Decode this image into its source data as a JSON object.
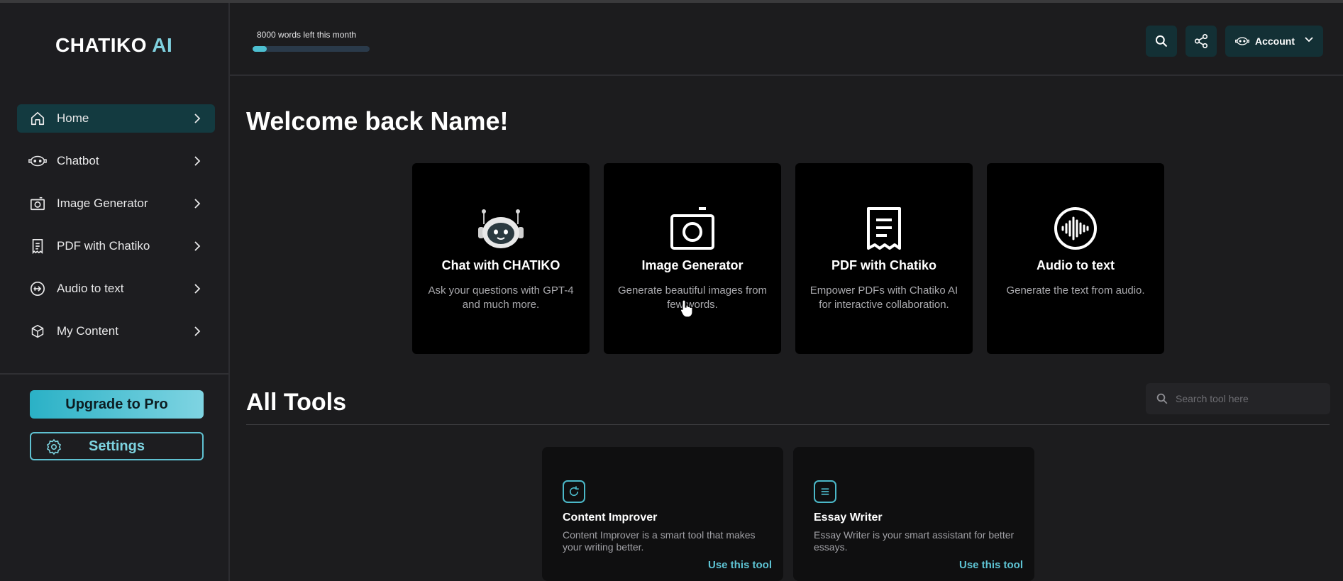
{
  "brand": {
    "name": "CHATIKO",
    "suffix": "AI",
    "accent": "#4dbfd0"
  },
  "sidebar": {
    "items": [
      {
        "label": "Home",
        "icon": "home-icon",
        "active": true
      },
      {
        "label": "Chatbot",
        "icon": "robot-face-icon"
      },
      {
        "label": "Image Generator",
        "icon": "camera-icon"
      },
      {
        "label": "PDF with Chatiko",
        "icon": "document-icon"
      },
      {
        "label": "Audio to text",
        "icon": "audio-arrow-icon"
      },
      {
        "label": "My Content",
        "icon": "cube-icon"
      }
    ],
    "upgrade_label": "Upgrade to Pro",
    "settings_label": "Settings"
  },
  "header": {
    "words_left": "8000 words left this month",
    "words_progress": 0.12,
    "account_label": "Account"
  },
  "main": {
    "welcome": "Welcome back Name!",
    "features": [
      {
        "title": "Chat with CHATIKO",
        "desc": "Ask your questions with GPT-4 and much more.",
        "icon": "robot-icon"
      },
      {
        "title": "Image Generator",
        "desc": "Generate beautiful images from few words.",
        "icon": "camera-icon"
      },
      {
        "title": "PDF with Chatiko",
        "desc": "Empower PDFs with Chatiko AI for interactive collaboration.",
        "icon": "document-icon"
      },
      {
        "title": "Audio to text",
        "desc": "Generate the text from audio.",
        "icon": "soundwave-icon"
      }
    ],
    "all_tools_title": "All Tools",
    "search_placeholder": "Search tool here",
    "tools": [
      {
        "title": "Content Improver",
        "desc": "Content Improver is a smart tool that makes your writing better.",
        "link": "Use this tool",
        "icon": "refresh-icon"
      },
      {
        "title": "Essay Writer",
        "desc": "Essay Writer is your smart assistant for better essays.",
        "link": "Use this tool",
        "icon": "list-icon"
      }
    ]
  }
}
